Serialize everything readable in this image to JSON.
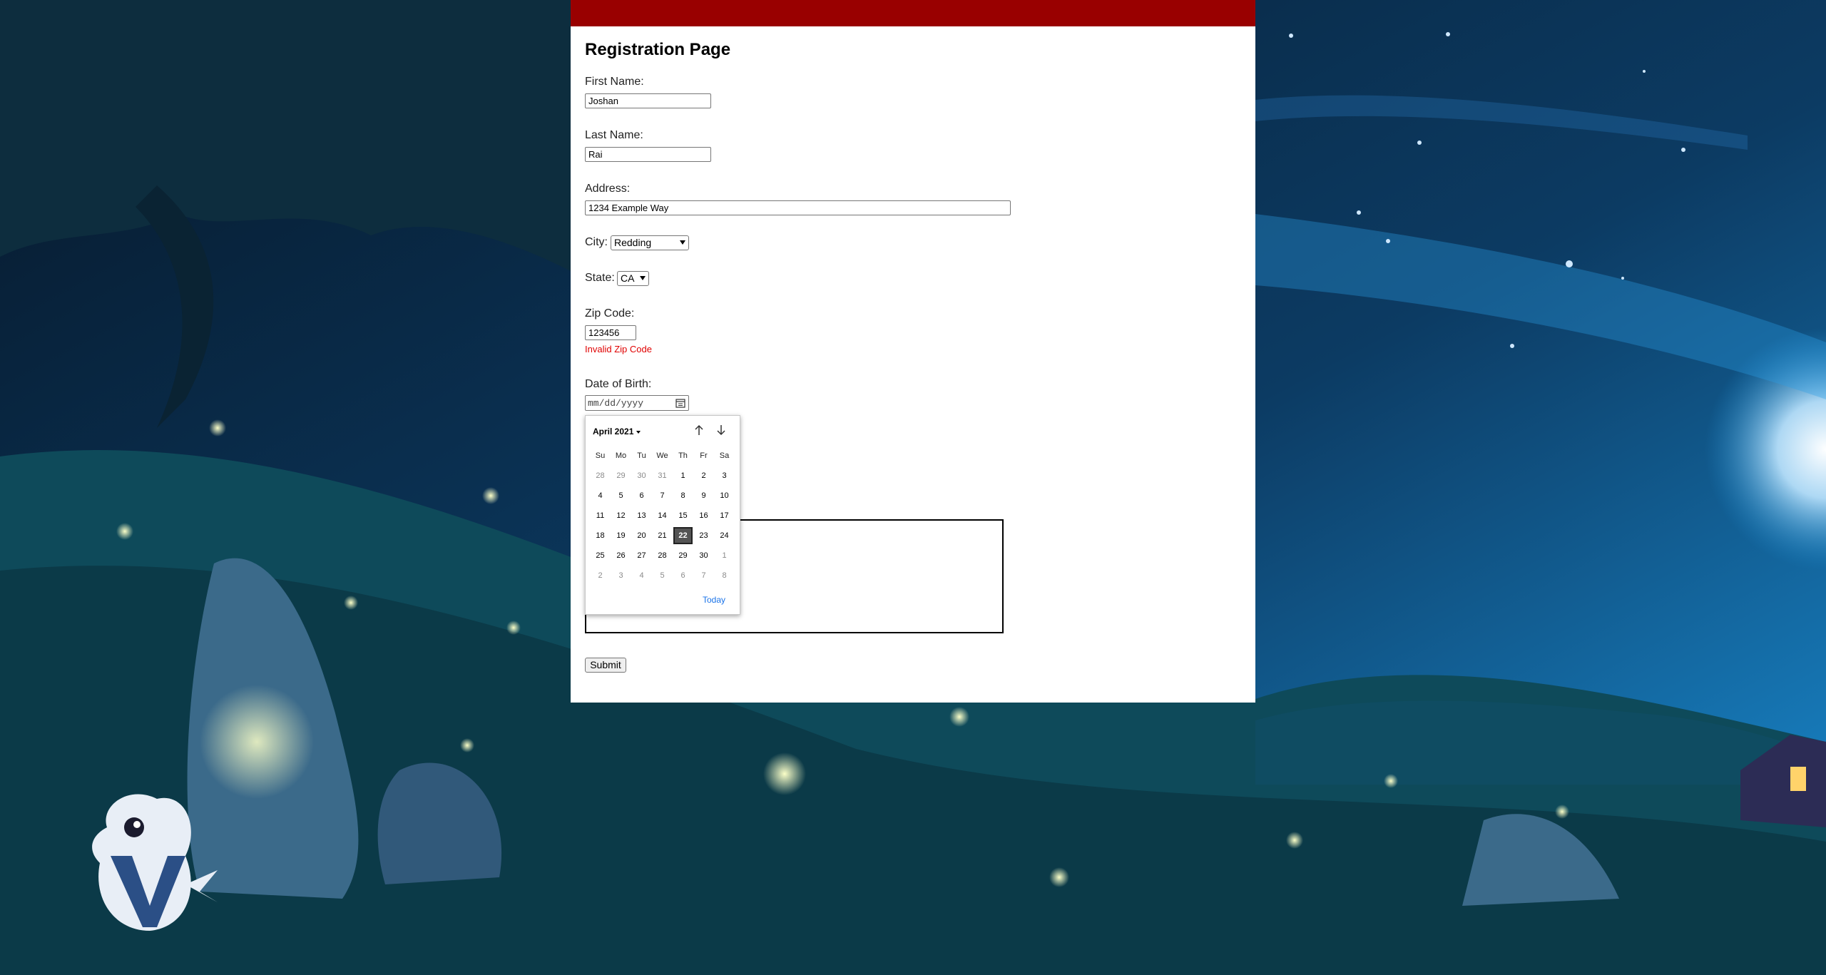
{
  "page": {
    "title": "Registration Page",
    "accent_color": "#990000"
  },
  "form": {
    "first_name": {
      "label": "First Name:",
      "value": "Joshan"
    },
    "last_name": {
      "label": "Last Name:",
      "value": "Rai"
    },
    "address": {
      "label": "Address:",
      "value": "1234 Example Way"
    },
    "city": {
      "label": "City:",
      "selected": "Redding"
    },
    "state": {
      "label": "State:",
      "selected": "CA"
    },
    "zip": {
      "label": "Zip Code:",
      "value": "123456",
      "error": "Invalid Zip Code"
    },
    "dob": {
      "label": "Date of Birth:",
      "placeholder": "mm/dd/yyyy"
    },
    "submit_label": "Submit"
  },
  "datepicker": {
    "month_label": "April 2021",
    "weekdays": [
      "Su",
      "Mo",
      "Tu",
      "We",
      "Th",
      "Fr",
      "Sa"
    ],
    "weeks": [
      [
        "28",
        "29",
        "30",
        "31",
        "1",
        "2",
        "3"
      ],
      [
        "4",
        "5",
        "6",
        "7",
        "8",
        "9",
        "10"
      ],
      [
        "11",
        "12",
        "13",
        "14",
        "15",
        "16",
        "17"
      ],
      [
        "18",
        "19",
        "20",
        "21",
        "22",
        "23",
        "24"
      ],
      [
        "25",
        "26",
        "27",
        "28",
        "29",
        "30",
        "1"
      ],
      [
        "2",
        "3",
        "4",
        "5",
        "6",
        "7",
        "8"
      ]
    ],
    "selected_day": "22",
    "today_label": "Today",
    "today_link_color": "#1a73e8"
  },
  "error_color": "#e00000"
}
